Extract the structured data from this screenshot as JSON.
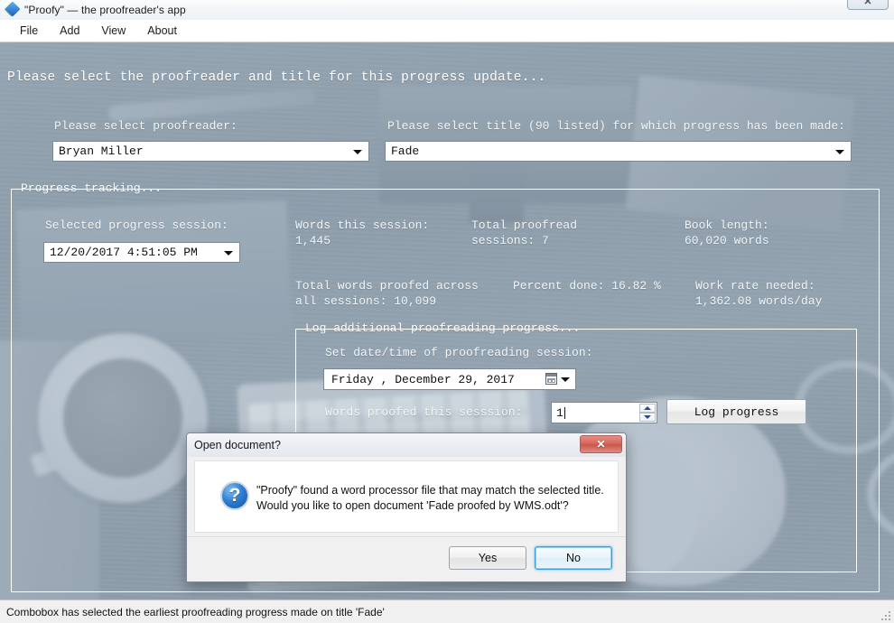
{
  "window": {
    "title": "\"Proofy\" — the proofreader's app",
    "icon": "app-diamond-icon",
    "close_label": "✕"
  },
  "menubar": {
    "items": [
      {
        "label": "File"
      },
      {
        "label": "Add"
      },
      {
        "label": "View"
      },
      {
        "label": "About"
      }
    ]
  },
  "main": {
    "headline": "Please select the proofreader and title for this progress update...",
    "proofreader": {
      "label": "Please select proofreader:",
      "value": "Bryan Miller"
    },
    "title_select": {
      "label": "Please select title (90 listed) for which progress has been made:",
      "value": "Fade"
    }
  },
  "progress_group": {
    "title": "Progress tracking...",
    "session": {
      "label": "Selected progress session:",
      "value": "12/20/2017 4:51:05 PM"
    },
    "stats": [
      {
        "label": "Words this session:",
        "value": "1,445"
      },
      {
        "label": "Total proofread",
        "value": "sessions: 7"
      },
      {
        "label": "Book length:",
        "value": "60,020 words"
      },
      {
        "label": "Total words proofed across",
        "value": "all sessions: 10,099"
      },
      {
        "label": "Percent done: 16.82 %",
        "value": ""
      },
      {
        "label": "Work rate needed:",
        "value": "1,362.08 words/day"
      }
    ]
  },
  "log_group": {
    "title": "Log additional proofreading progress...",
    "date_label": "Set date/time of proofreading session:",
    "date_value": "Friday  ,  December  29, 2017",
    "words_label": "Words proofed this sesssion:",
    "words_value": "1",
    "log_button": "Log progress"
  },
  "dialog": {
    "title": "Open document?",
    "close_label": "✕",
    "icon": "question-icon",
    "message_line1": "\"Proofy\" found a word processor file that may match the selected title.",
    "message_line2": "Would you like to open document 'Fade proofed by WMS.odt'?",
    "yes_label": "Yes",
    "no_label": "No"
  },
  "statusbar": {
    "text": "Combobox has selected the earliest proofreading progress made on title 'Fade'"
  },
  "colors": {
    "accent_focus": "#3c9cda",
    "close_red": "#d9665a",
    "photo_tint": "#8d9ba6",
    "text_on_photo": "#ffffff"
  }
}
